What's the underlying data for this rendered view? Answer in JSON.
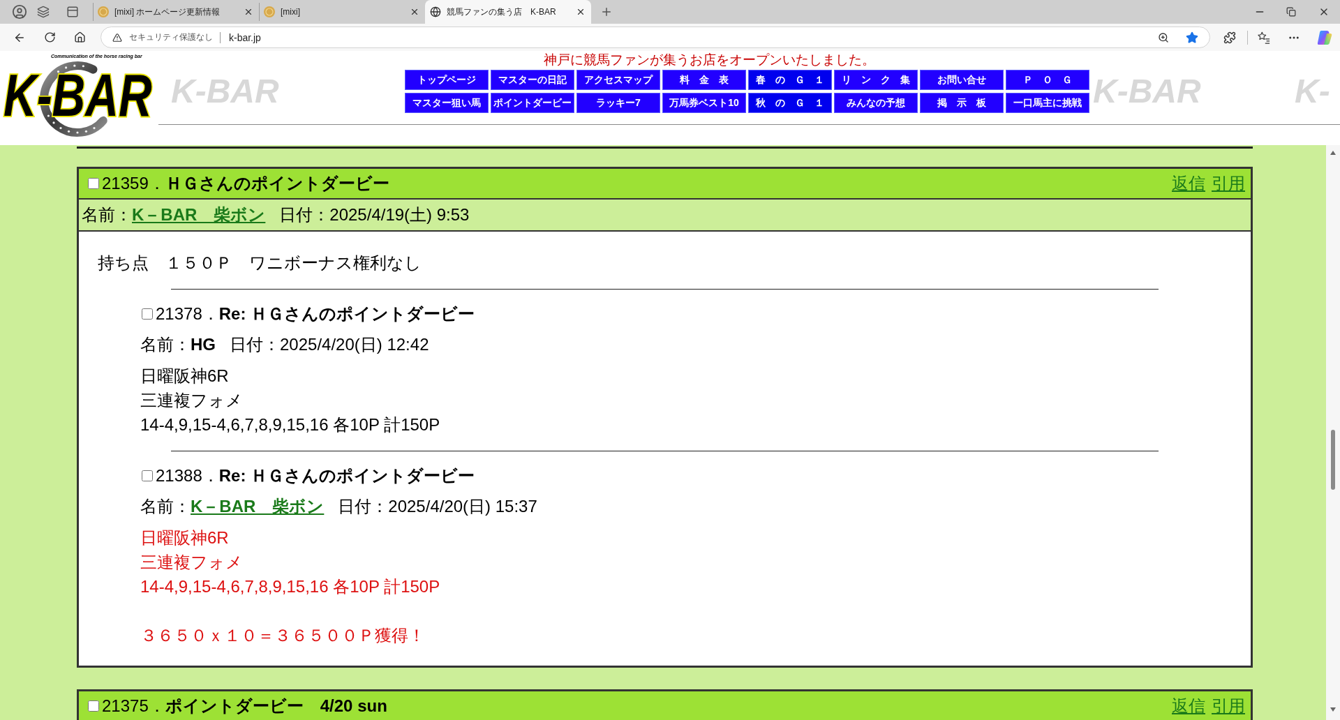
{
  "browser": {
    "tabs": [
      {
        "kind": "mixi",
        "title": "[mixi] ホームページ更新情報",
        "selected": false
      },
      {
        "kind": "mixi",
        "title": "[mixi]",
        "selected": false
      },
      {
        "kind": "site",
        "title": "競馬ファンの集う店　K-BAR",
        "selected": true
      }
    ],
    "address": {
      "security": "セキュリティ保護なし",
      "url": "k-bar.jp",
      "favorite": true
    }
  },
  "header": {
    "logo": {
      "title": "K-BAR",
      "tagline": "Communication of the horse racing bar"
    },
    "background_marks": [
      "K-BAR",
      "K-BAR",
      "K-"
    ],
    "announcement": "神戸に競馬ファンが集うお店をオープンいたしました。",
    "nav": [
      {
        "label": "トップページ",
        "color": "#2200ff"
      },
      {
        "label": "マスターの日記",
        "color": "#2200ff"
      },
      {
        "label": "アクセスマップ",
        "color": "#2200ff"
      },
      {
        "label": "料　金　表",
        "color": "#2200ff"
      },
      {
        "label": "春　の　Ｇ　１",
        "color": "#0000ee"
      },
      {
        "label": "リ　ン　ク　集",
        "color": "#2200ff"
      },
      {
        "label": "お問い合せ",
        "color": "#2200ff"
      },
      {
        "label": "Ｐ　Ｏ　Ｇ",
        "color": "#2200ff"
      },
      {
        "label": "マスター狙い馬",
        "color": "#2200ff"
      },
      {
        "label": "ポイントダービー",
        "color": "#2200ff"
      },
      {
        "label": "ラッキー7",
        "color": "#2200ff"
      },
      {
        "label": "万馬券ベスト10",
        "color": "#2200ff"
      },
      {
        "label": "秋　の　Ｇ　１",
        "color": "#0000ee"
      },
      {
        "label": "みんなの予想",
        "color": "#2200ff"
      },
      {
        "label": "掲　示　板",
        "color": "#2200ff"
      },
      {
        "label": "一口馬主に挑戦",
        "color": "#2200ff"
      }
    ]
  },
  "board": {
    "posts": [
      {
        "checked": false,
        "number": "21359．",
        "title": "ＨＧさんのポイントダービー",
        "actions": [
          "返信",
          "引用"
        ],
        "name_label": "名前：",
        "author": {
          "name": "K－BAR　柴ボン",
          "link": true
        },
        "date": "日付：2025/4/19(土) 9:53",
        "message": {
          "color": "#000000",
          "paragraphs": [
            [
              "持ち点　１５０Ｐ　ワニボーナス権利なし"
            ]
          ]
        },
        "replies": [
          {
            "checked": false,
            "number": "21378．",
            "title": "Re: ＨＧさんのポイントダービー",
            "name_label": "名前：",
            "author": {
              "name": "HG",
              "link": false
            },
            "date": "日付：2025/4/20(日) 12:42",
            "message": {
              "color": "#000000",
              "paragraphs": [
                [
                  "日曜阪神6R",
                  "三連複フォメ",
                  "14-4,9,15-4,6,7,8,9,15,16 各10P 計150P"
                ]
              ]
            }
          },
          {
            "checked": false,
            "number": "21388．",
            "title": "Re: ＨＧさんのポイントダービー",
            "name_label": "名前：",
            "author": {
              "name": "K－BAR　柴ボン",
              "link": true
            },
            "date": "日付：2025/4/20(日) 15:37",
            "message": {
              "color": "#dd1111",
              "paragraphs": [
                [
                  "日曜阪神6R",
                  "三連複フォメ",
                  "14-4,9,15-4,6,7,8,9,15,16 各10P 計150P"
                ],
                [
                  "３６５０ｘ１０＝３６５００Ｐ獲得！"
                ]
              ]
            }
          }
        ]
      },
      {
        "checked": false,
        "number": "21375．",
        "title": "ポイントダービー　4/20 sun",
        "actions": [
          "返信",
          "引用"
        ]
      }
    ]
  }
}
